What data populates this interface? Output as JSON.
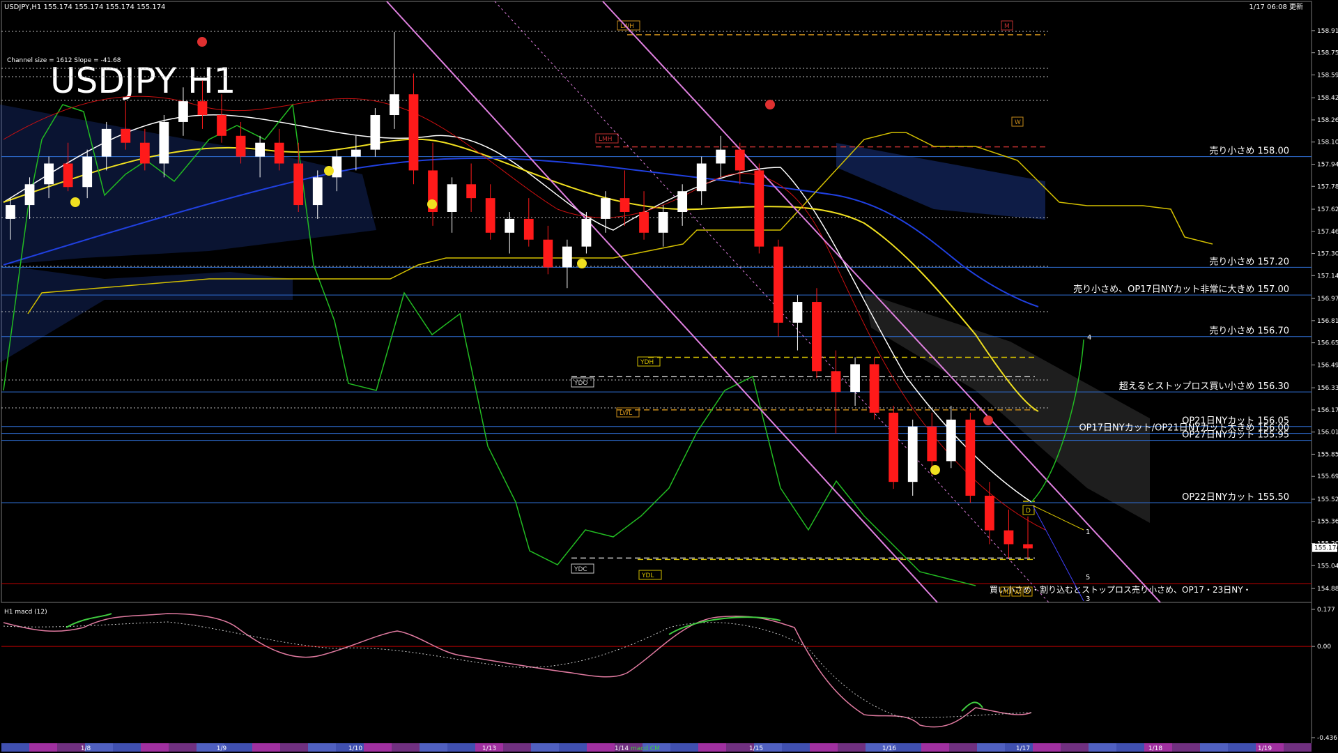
{
  "header": {
    "symbol_info": "USDJPY,H1  155.174 155.174 155.174 155.174",
    "timestamp": "1/17 06:08 更新",
    "channel_info": "Channel size = 1612 Slope = -41.68",
    "big_title": "USDJPY H1"
  },
  "price_axis": {
    "ticks": [
      "158.910",
      "158.750",
      "158.590",
      "158.425",
      "158.265",
      "158.105",
      "157.945",
      "157.785",
      "157.620",
      "157.460",
      "157.300",
      "157.140",
      "156.975",
      "156.815",
      "156.655",
      "156.495",
      "156.330",
      "156.170",
      "156.010",
      "155.850",
      "155.690",
      "155.525",
      "155.365",
      "155.205",
      "155.045",
      "154.880"
    ],
    "current_price": "155.174"
  },
  "levels": [
    {
      "price": 158.0,
      "label": "売り小さめ 158.00"
    },
    {
      "price": 157.2,
      "label": "売り小さめ 157.20"
    },
    {
      "price": 157.0,
      "label": "売り小さめ、OP17日NYカット非常に大きめ 157.00"
    },
    {
      "price": 156.7,
      "label": "売り小さめ 156.70"
    },
    {
      "price": 156.3,
      "label": "超えるとストップロス買い小さめ 156.30"
    },
    {
      "price": 156.05,
      "label": "OP21日NYカット 156.05"
    },
    {
      "price": 156.0,
      "label": "OP17日NYカット/OP21日NYカット大きめ 156.00"
    },
    {
      "price": 155.95,
      "label": "OP27日NYカット 155.95"
    },
    {
      "price": 155.5,
      "label": "OP22日NYカット 155.50"
    }
  ],
  "bottom_level_text": "買い小さめ・割り込むとストップロス売り小さめ、OP17・23日NY・",
  "ref_lines": [
    {
      "tag": "LWH",
      "price": 158.88,
      "color": "#c88b1a"
    },
    {
      "tag": "M",
      "price": 158.88,
      "color": "#c03030"
    },
    {
      "tag": "LMH",
      "price": 158.07,
      "color": "#c03030"
    },
    {
      "tag": "W",
      "price": 158.22,
      "color": "#c88b1a"
    },
    {
      "tag": "YDH",
      "price": 156.55,
      "color": "#d4c000"
    },
    {
      "tag": "YDO",
      "price": 156.41,
      "color": "#cccccc"
    },
    {
      "tag": "LWL",
      "price": 156.17,
      "color": "#c88b1a"
    },
    {
      "tag": "YDC",
      "price": 155.1,
      "color": "#cccccc"
    },
    {
      "tag": "YDL",
      "price": 155.09,
      "color": "#d4c000"
    },
    {
      "tag": "D",
      "price": 155.51,
      "color": "#d4c000"
    }
  ],
  "bottom_tags": [
    "M",
    "W",
    "D"
  ],
  "projection_labels": [
    "1",
    "4",
    "5",
    "3"
  ],
  "macd": {
    "title": "H1  macd (12)",
    "ticks": [
      "0.177",
      "0.00",
      "-0.436"
    ]
  },
  "date_axis": {
    "dates": [
      "1/8",
      "1/9",
      "1/10",
      "1/13",
      "1/14",
      "1/15",
      "1/16",
      "1/17",
      "1/18",
      "1/19"
    ],
    "tag": "macd CM"
  },
  "chart_data": {
    "type": "candlestick",
    "title": "USDJPY H1",
    "ylim": [
      154.85,
      158.98
    ],
    "candles": [
      [
        157.55,
        157.7,
        157.4,
        157.65
      ],
      [
        157.65,
        157.85,
        157.55,
        157.8
      ],
      [
        157.8,
        158.0,
        157.7,
        157.95
      ],
      [
        157.95,
        158.1,
        157.75,
        157.78
      ],
      [
        157.78,
        158.05,
        157.7,
        158.0
      ],
      [
        158.0,
        158.25,
        157.9,
        158.2
      ],
      [
        158.2,
        158.4,
        158.05,
        158.1
      ],
      [
        158.1,
        158.2,
        157.9,
        157.95
      ],
      [
        157.95,
        158.3,
        157.85,
        158.25
      ],
      [
        158.25,
        158.5,
        158.15,
        158.4
      ],
      [
        158.4,
        158.55,
        158.2,
        158.3
      ],
      [
        158.3,
        158.45,
        158.1,
        158.15
      ],
      [
        158.15,
        158.25,
        157.95,
        158.0
      ],
      [
        158.0,
        158.15,
        157.85,
        158.1
      ],
      [
        158.1,
        158.2,
        157.9,
        157.95
      ],
      [
        157.95,
        158.1,
        157.6,
        157.65
      ],
      [
        157.65,
        157.9,
        157.55,
        157.85
      ],
      [
        157.85,
        158.05,
        157.75,
        158.0
      ],
      [
        158.0,
        158.15,
        157.9,
        158.05
      ],
      [
        158.05,
        158.35,
        158.0,
        158.3
      ],
      [
        158.3,
        158.9,
        158.2,
        158.45
      ],
      [
        158.45,
        158.6,
        157.8,
        157.9
      ],
      [
        157.9,
        158.1,
        157.5,
        157.6
      ],
      [
        157.6,
        157.85,
        157.45,
        157.8
      ],
      [
        157.8,
        157.95,
        157.6,
        157.7
      ],
      [
        157.7,
        157.8,
        157.4,
        157.45
      ],
      [
        157.45,
        157.6,
        157.3,
        157.55
      ],
      [
        157.55,
        157.7,
        157.35,
        157.4
      ],
      [
        157.4,
        157.5,
        157.15,
        157.2
      ],
      [
        157.2,
        157.4,
        157.05,
        157.35
      ],
      [
        157.35,
        157.6,
        157.3,
        157.55
      ],
      [
        157.55,
        157.75,
        157.45,
        157.7
      ],
      [
        157.7,
        157.9,
        157.5,
        157.6
      ],
      [
        157.6,
        157.75,
        157.4,
        157.45
      ],
      [
        157.45,
        157.65,
        157.35,
        157.6
      ],
      [
        157.6,
        157.8,
        157.5,
        157.75
      ],
      [
        157.75,
        158.0,
        157.65,
        157.95
      ],
      [
        157.95,
        158.15,
        157.85,
        158.05
      ],
      [
        158.05,
        158.1,
        157.8,
        157.9
      ],
      [
        157.9,
        157.95,
        157.3,
        157.35
      ],
      [
        157.35,
        157.4,
        156.7,
        156.8
      ],
      [
        156.8,
        157.0,
        156.6,
        156.95
      ],
      [
        156.95,
        157.05,
        156.4,
        156.45
      ],
      [
        156.45,
        156.6,
        156.0,
        156.3
      ],
      [
        156.3,
        156.55,
        156.2,
        156.5
      ],
      [
        156.5,
        156.55,
        156.1,
        156.15
      ],
      [
        156.15,
        156.2,
        155.6,
        155.65
      ],
      [
        155.65,
        156.1,
        155.55,
        156.05
      ],
      [
        156.05,
        156.15,
        155.7,
        155.8
      ],
      [
        155.8,
        156.2,
        155.75,
        156.1
      ],
      [
        156.1,
        156.15,
        155.5,
        155.55
      ],
      [
        155.55,
        155.65,
        155.2,
        155.3
      ],
      [
        155.3,
        155.45,
        155.1,
        155.2
      ],
      [
        155.2,
        155.4,
        155.1,
        155.17
      ]
    ]
  }
}
